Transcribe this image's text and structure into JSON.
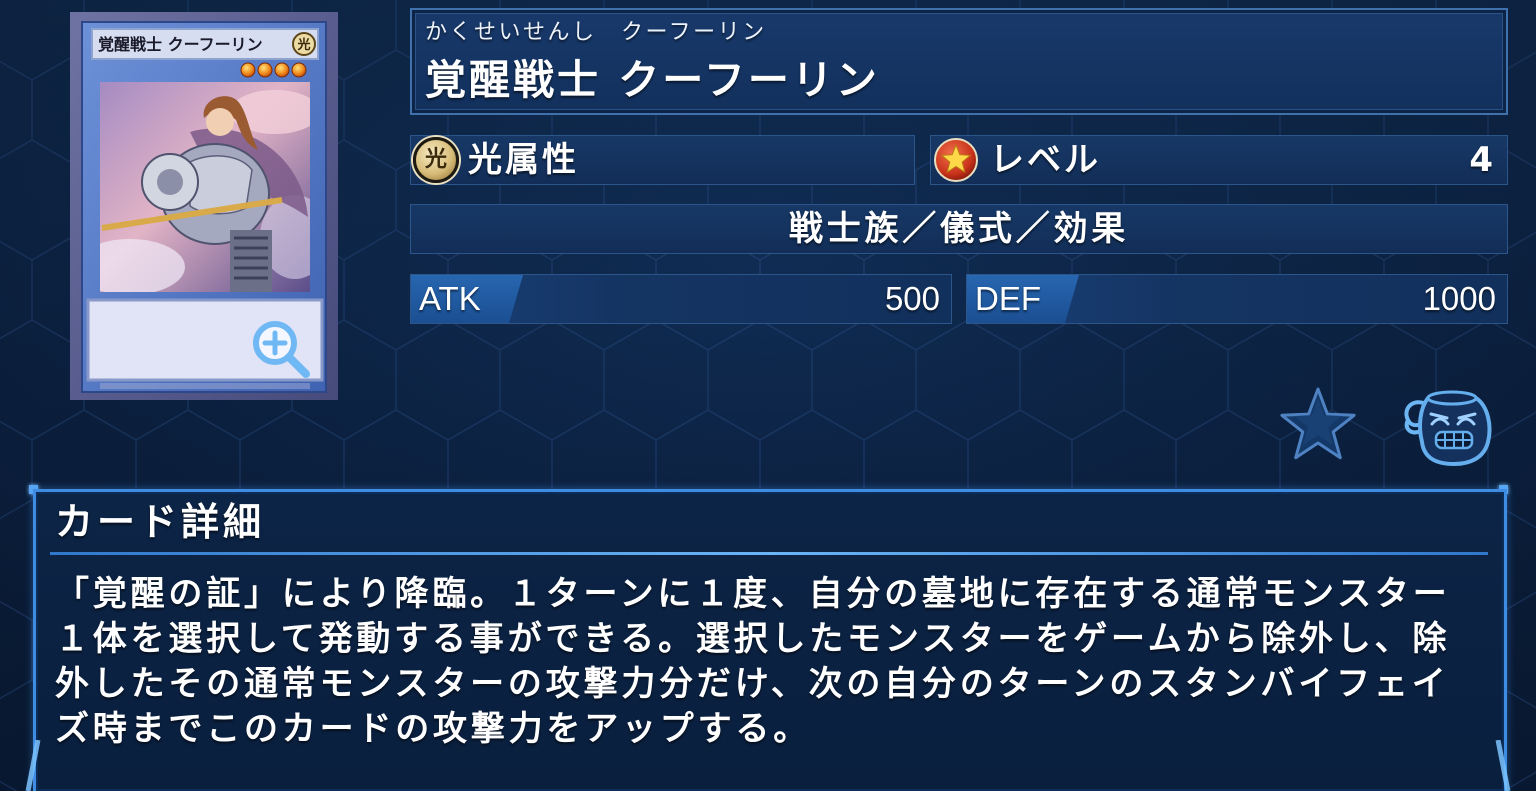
{
  "card_image": {
    "name": "覚醒戦士 クーフーリン",
    "attribute_glyph": "光",
    "level_stars": 4,
    "zoom_icon": "zoom-in-icon"
  },
  "header": {
    "ruby": "かくせいせんし　クーフーリン",
    "name": "覚醒戦士 クーフーリン"
  },
  "attribute": {
    "icon": "light-attribute-icon",
    "icon_glyph": "光",
    "label": "光属性"
  },
  "level": {
    "icon": "level-star-icon",
    "label": "レベル",
    "value": "4"
  },
  "type_line": "戦士族／儀式／効果",
  "stats": {
    "atk_label": "ATK",
    "atk_value": "500",
    "def_label": "DEF",
    "def_value": "1000"
  },
  "actions": {
    "favorite_icon": "star-icon",
    "pot_icon": "pot-icon"
  },
  "details": {
    "title": "カード詳細",
    "lines": [
      "「覚醒の証」により降臨。１ターンに１度、自分の墓地に存在する通常モンスター",
      "１体を選択して発動する事ができる。選択したモンスターをゲームから除外し、除",
      "外したその通常モンスターの攻撃力分だけ、次の自分のターンのスタンバイフェイ",
      "ズ時までこのカードの攻撃力をアップする。"
    ]
  },
  "colors": {
    "background": "#0b2040",
    "panel_border": "#3f8de2",
    "box_bg": "#153460",
    "stat_label_bg": "#1f5293",
    "card_frame": "#5b7fca"
  }
}
